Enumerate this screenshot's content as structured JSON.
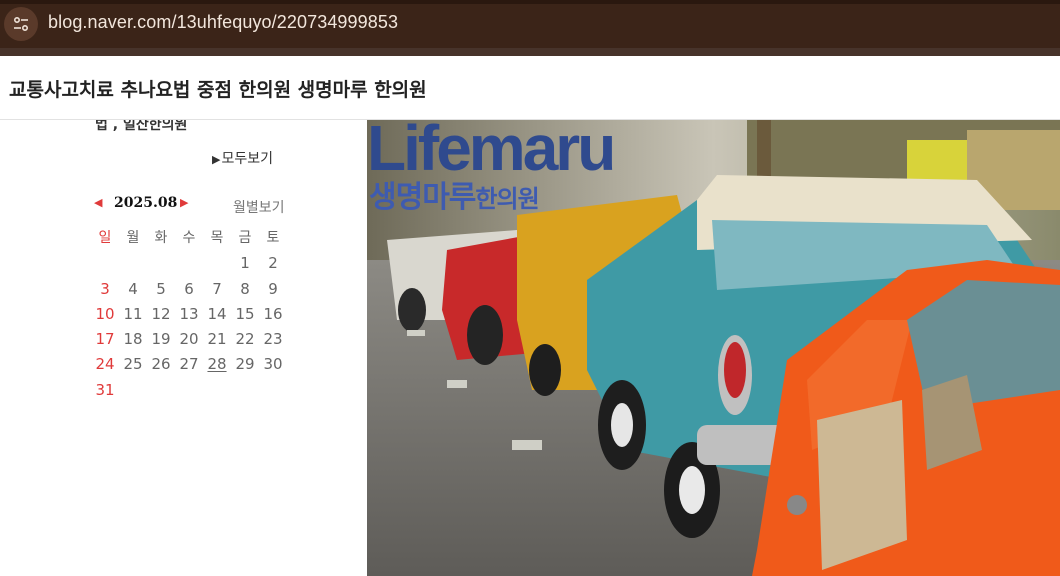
{
  "browser": {
    "url": "blog.naver.com/13uhfequyo/220734999853",
    "site_info_icon": "tune-icon"
  },
  "blog": {
    "title": "교통사고치료 추나요법 중점 한의원 생명마루 한의원"
  },
  "sidebar": {
    "category_partial": "법 , 일산한의원",
    "view_all_label": "모두보기",
    "calendar": {
      "month": "2025.08",
      "monthly_view_label": "월별보기",
      "weekdays": [
        "일",
        "월",
        "화",
        "수",
        "목",
        "금",
        "토"
      ],
      "weeks": [
        [
          "",
          "",
          "",
          "",
          "",
          "1",
          "2"
        ],
        [
          "3",
          "4",
          "5",
          "6",
          "7",
          "8",
          "9"
        ],
        [
          "10",
          "11",
          "12",
          "13",
          "14",
          "15",
          "16"
        ],
        [
          "17",
          "18",
          "19",
          "20",
          "21",
          "22",
          "23"
        ],
        [
          "24",
          "25",
          "26",
          "27",
          "28",
          "29",
          "30"
        ],
        [
          "31",
          "",
          "",
          "",
          "",
          "",
          ""
        ]
      ],
      "highlighted_day": "28"
    }
  },
  "banner": {
    "logo_text": "Lifemaru",
    "logo_korean_main": "생명마루",
    "logo_korean_sub": "한의원",
    "logo_color": "#2f4a8e"
  }
}
